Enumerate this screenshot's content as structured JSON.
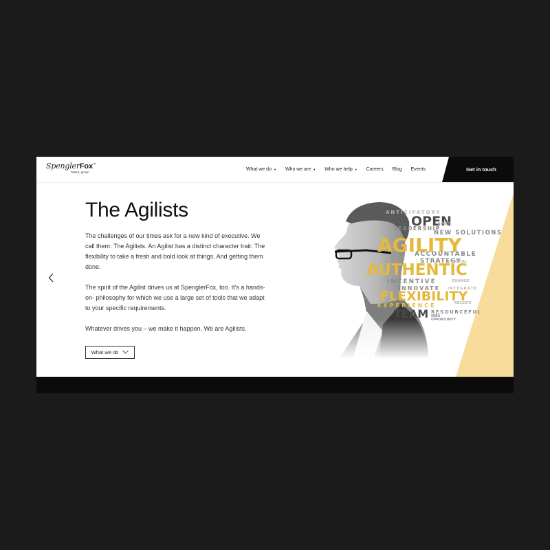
{
  "brand": {
    "name_script": "Spengler",
    "name_bold": "Fox",
    "trademark": "™",
    "tagline": "Talent, grown."
  },
  "nav": {
    "items": [
      {
        "label": "What we do",
        "dropdown": true
      },
      {
        "label": "Who we are",
        "dropdown": true
      },
      {
        "label": "Who we help",
        "dropdown": true
      },
      {
        "label": "Careers",
        "dropdown": false
      },
      {
        "label": "Blog",
        "dropdown": false
      },
      {
        "label": "Events",
        "dropdown": false
      }
    ],
    "cta_label": "Get in touch"
  },
  "hero": {
    "title": "The Agilists",
    "paragraphs": [
      "The challenges of our times ask for a new kind of executive. We call them: The Agilists. An Agilist has a distinct character trait: The flexibility to take a fresh and bold look at things. And getting them done.",
      "The spirit of the Agilist drives us at SpenglerFox, too. It's a hands-on- philosophy for which we use a large set of tools that we adapt to your specific requirements.",
      "Whatever drives you – we make it happen. We are Agilists."
    ],
    "button_label": "What we do"
  },
  "word_cloud": {
    "words": [
      "ANTICIPATORY",
      "OPEN",
      "SWIFT",
      "LEADERSHIP",
      "NEW SOLUTIONS",
      "AGILITY",
      "ACCOUNTABLE",
      "STRATEGY",
      "DIGITAL",
      "AUTHENTIC",
      "INCENTIVE",
      "CHANGE",
      "INNOVATE",
      "INTEGRATE",
      "FLEXIBILITY",
      "EXPERIENCE",
      "RESULTS",
      "TEAM",
      "RESOURCEFUL",
      "IDEA",
      "OPPORTUNITY"
    ]
  },
  "colors": {
    "accent_yellow": "#f7dc9b",
    "gold_text": "#e6b93c",
    "dark": "#0b0b0b",
    "page_bg": "#1b1b1b"
  },
  "icons": [
    "chevron-left-icon",
    "chevron-right-icon",
    "chevron-down-icon",
    "caret-down-icon"
  ]
}
